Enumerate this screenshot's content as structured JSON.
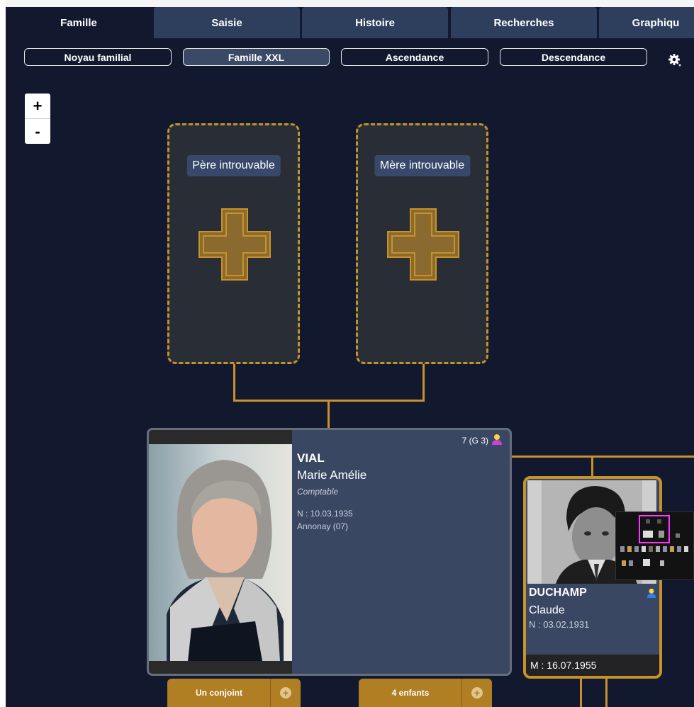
{
  "tabs": [
    {
      "label": "Famille",
      "active": true
    },
    {
      "label": "Saisie",
      "active": false
    },
    {
      "label": "Histoire",
      "active": false
    },
    {
      "label": "Recherches",
      "active": false
    },
    {
      "label": "Graphiqu",
      "active": false
    }
  ],
  "subnav": [
    {
      "label": "Noyau familial",
      "active": false
    },
    {
      "label": "Famille XXL",
      "active": true
    },
    {
      "label": "Ascendance",
      "active": false
    },
    {
      "label": "Descendance",
      "active": false
    }
  ],
  "zoom": {
    "in": "+",
    "out": "-"
  },
  "placeholders": {
    "father": "Père introuvable",
    "mother": "Mère introuvable"
  },
  "main_person": {
    "count": "7 (G 3)",
    "surname": "VIAL",
    "given": "Marie Amélie",
    "occupation": "Comptable",
    "birth": "N : 10.03.1935",
    "birth_place": "Annonay (07)",
    "icon": "person-female-icon"
  },
  "buttons": {
    "spouse": "Un conjoint",
    "children": "4 enfants"
  },
  "spouse": {
    "surname": "DUCHAMP",
    "given": "Claude",
    "birth": "N : 03.02.1931",
    "marriage": "M : 16.07.1955",
    "icon": "person-male-icon"
  },
  "colors": {
    "background": "#12192f",
    "tab": "#2d3f5d",
    "accent_gold": "#c7922a",
    "card": "#394762"
  }
}
